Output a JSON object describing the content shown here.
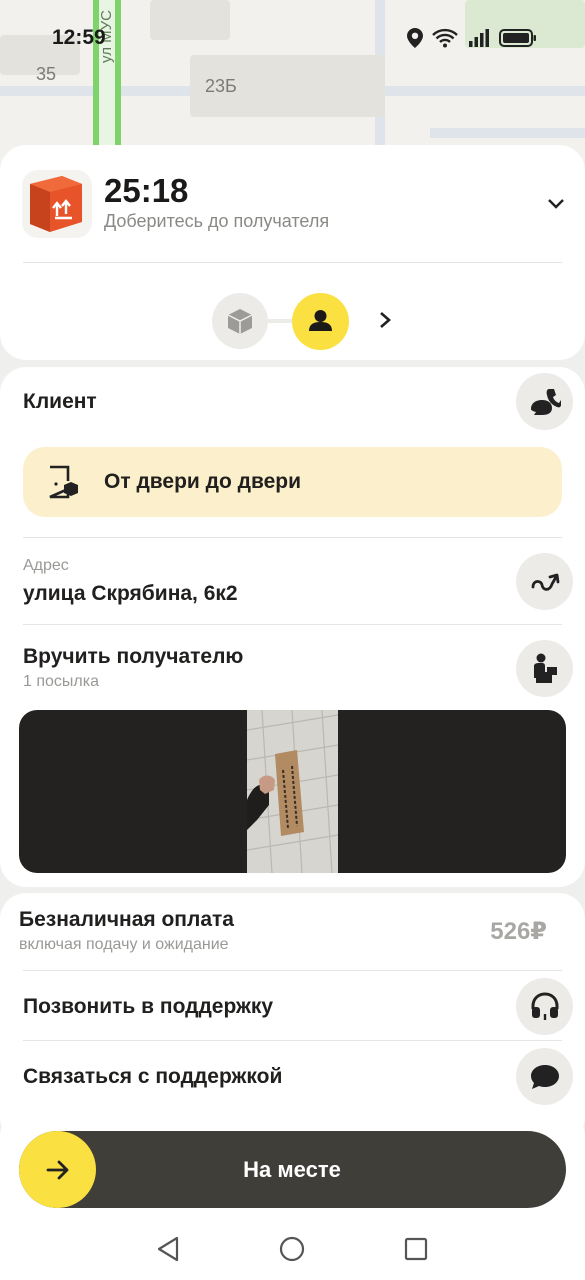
{
  "status_bar": {
    "time": "12:59"
  },
  "map": {
    "label_35": "35",
    "label_23b": "23Б",
    "street_label": "ул МУС"
  },
  "order": {
    "timer": "25:18",
    "timer_subtitle": "Доберитесь до получателя"
  },
  "client": {
    "label": "Клиент"
  },
  "delivery_type": {
    "label": "От двери до двери"
  },
  "address": {
    "caption": "Адрес",
    "value": "улица Скрябина, 6к2"
  },
  "handover": {
    "title": "Вручить получателю",
    "subtitle": "1 посылка"
  },
  "payment": {
    "title": "Безналичная оплата",
    "subtitle": "включая подачу и ожидание",
    "amount": "526₽"
  },
  "support": {
    "call_label": "Позвонить в поддержку",
    "chat_label": "Связаться с поддержкой"
  },
  "action": {
    "label": "На месте"
  },
  "colors": {
    "accent_yellow": "#fbe041",
    "dark_button": "#403e38",
    "banner_bg": "#fcf0cc",
    "box_orange": "#e8542a"
  }
}
